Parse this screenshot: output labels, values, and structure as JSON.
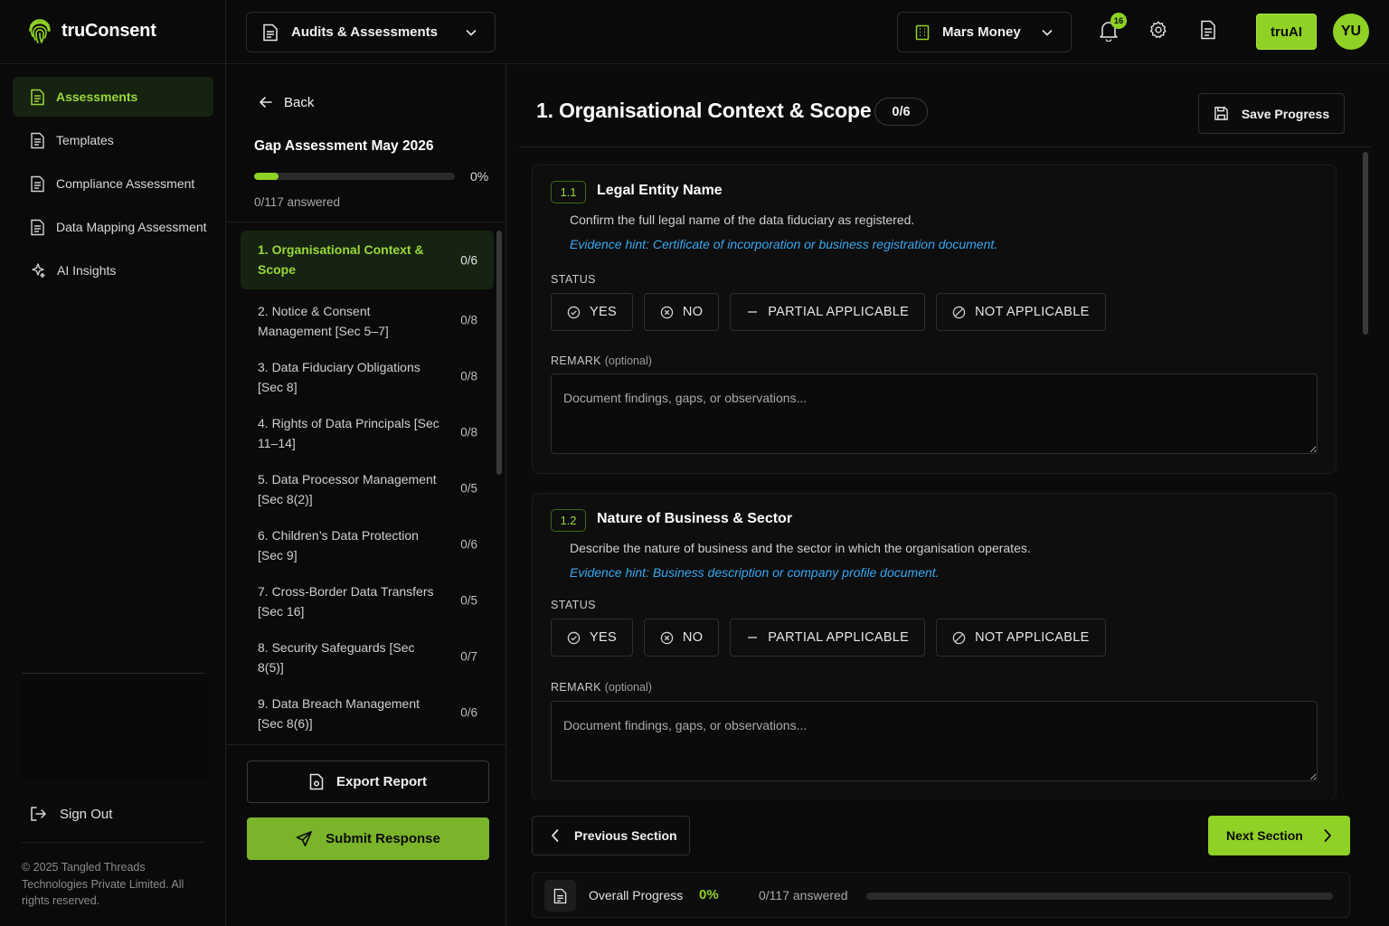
{
  "brand": {
    "name": "truConsent"
  },
  "nav": {
    "items": [
      {
        "label": "Assessments",
        "icon": "document-icon",
        "active": true
      },
      {
        "label": "Templates",
        "icon": "document-icon"
      },
      {
        "label": "Compliance Assessment",
        "icon": "document-icon"
      },
      {
        "label": "Data Mapping Assessment",
        "icon": "document-icon"
      },
      {
        "label": "AI Insights",
        "icon": "sparkle-icon"
      }
    ],
    "sign_out": "Sign Out",
    "copyright": "© 2025 Tangled Threads Technologies Private Limited. All rights reserved."
  },
  "topbar": {
    "module_selector": "Audits & Assessments",
    "org_selector": "Mars Money",
    "notification_count": "16",
    "truai_label": "truAI",
    "avatar_initials": "YU"
  },
  "assessment": {
    "back_label": "Back",
    "title": "Gap Assessment May 2026",
    "progress_percent_label": "0%",
    "progress_fraction": 0.12,
    "answered_label": "0/117 answered",
    "sections": [
      {
        "label": "1. Organisational Context & Scope",
        "count": "0/6",
        "active": true
      },
      {
        "label": "2. Notice & Consent Management [Sec 5–7]",
        "count": "0/8"
      },
      {
        "label": "3. Data Fiduciary Obligations [Sec 8]",
        "count": "0/8"
      },
      {
        "label": "4. Rights of Data Principals [Sec 11–14]",
        "count": "0/8"
      },
      {
        "label": "5. Data Processor Management [Sec 8(2)]",
        "count": "0/5"
      },
      {
        "label": "6. Children’s Data Protection [Sec 9]",
        "count": "0/6"
      },
      {
        "label": "7. Cross-Border Data Transfers [Sec 16]",
        "count": "0/5"
      },
      {
        "label": "8. Security Safeguards [Sec 8(5)]",
        "count": "0/7"
      },
      {
        "label": "9. Data Breach Management [Sec 8(6)]",
        "count": "0/6"
      }
    ],
    "export_label": "Export Report",
    "submit_label": "Submit Response"
  },
  "main": {
    "section_title": "1. Organisational Context & Scope",
    "section_count": "0/6",
    "save_label": "Save Progress",
    "status_label": "STATUS",
    "remark_label": "REMARK",
    "remark_optional": "(optional)",
    "remark_placeholder": "Document findings, gaps, or observations...",
    "options": [
      "YES",
      "NO",
      "PARTIAL APPLICABLE",
      "NOT APPLICABLE"
    ],
    "questions": [
      {
        "number": "1.1",
        "title": "Legal Entity Name",
        "description": "Confirm the full legal name of the data fiduciary as registered.",
        "hint": "Evidence hint: Certificate of incorporation or business registration document."
      },
      {
        "number": "1.2",
        "title": "Nature of Business & Sector",
        "description": "Describe the nature of business and the sector in which the organisation operates.",
        "hint": "Evidence hint: Business description or company profile document."
      }
    ],
    "prev_label": "Previous Section",
    "next_label": "Next Section",
    "overall_label": "Overall Progress",
    "overall_percent": "0%",
    "overall_answered": "0/117 answered",
    "overall_fraction": 0
  },
  "colors": {
    "accent": "#8fd125",
    "hint": "#3aa7f0",
    "background": "#0b0b0b"
  }
}
